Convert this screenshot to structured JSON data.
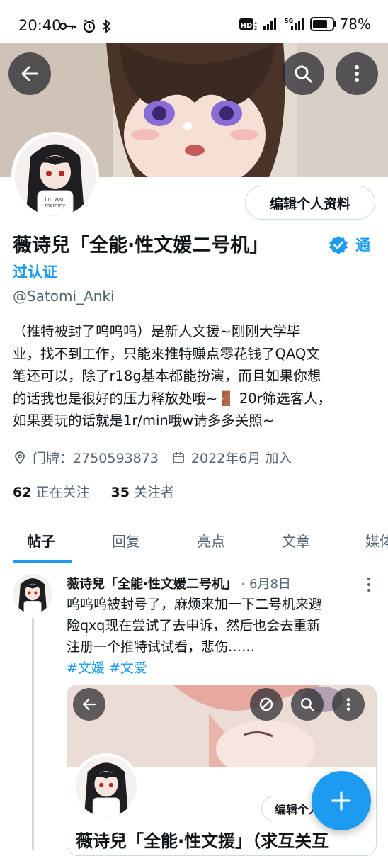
{
  "status_bar": {
    "time": "20:40",
    "battery": "78%",
    "battery_level": 0.78,
    "left_icons": [
      "key-icon",
      "alarm-icon",
      "bluetooth-icon"
    ],
    "right_icons": [
      "hd-icon",
      "signal-icon",
      "5g-signal-icon",
      "battery-icon"
    ]
  },
  "header": {
    "back_icon": "arrow-left-icon",
    "search_icon": "search-icon",
    "more_icon": "more-vertical-icon"
  },
  "profile": {
    "edit_button": "编辑个人资料",
    "name": "薇诗兒「全能·性文媛二号机」",
    "verified_text_1": "通",
    "verified_text_2": "过认证",
    "handle": "@Satomi_Anki",
    "bio_lines": [
      "（推特被封了呜呜呜）是新人文援~刚刚大学毕",
      "业，找不到工作，只能来推特赚点零花钱了QAQ文",
      "笔还可以，除了r18g基本都能扮演，而且如果你想",
      "的话我也是很好的压力释放处哦~🚪 20r筛选客人，",
      "如果要玩的话就是1r/min哦w请多多关照~"
    ],
    "location": "门牌：2750593873",
    "joined": "2022年6月 加入",
    "following_count": "62",
    "following_label": "正在关注",
    "followers_count": "35",
    "followers_label": "关注者"
  },
  "tabs": [
    {
      "label": "帖子",
      "active": true
    },
    {
      "label": "回复",
      "active": false
    },
    {
      "label": "亮点",
      "active": false
    },
    {
      "label": "文章",
      "active": false
    },
    {
      "label": "媒体",
      "active": false
    }
  ],
  "post": {
    "author": "薇诗兒「全能·性文媛二号机」",
    "date": "· 6月8日",
    "text_lines": [
      "呜呜呜被封号了，麻烦来加一下二号机来避",
      "险qxq现在尝试了去申诉，然后也会去重新",
      "注册一个推特试试看，悲伤……"
    ],
    "hashtags": "#文媛 #文爱",
    "embed": {
      "edit_button": "编辑个人资料",
      "name": "薇诗兒「全能·性文援」（求互关互"
    }
  },
  "fab_icon": "plus-icon",
  "colors": {
    "accent": "#1d9bf0",
    "text": "#0f1419",
    "secondary": "#536471"
  }
}
